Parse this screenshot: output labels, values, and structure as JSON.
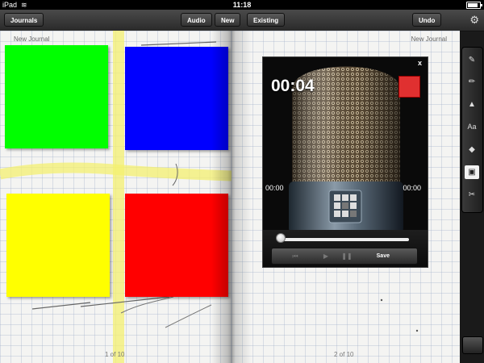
{
  "status_bar": {
    "carrier": "iPad",
    "wifi_icon": "wifi-icon",
    "time": "11:18",
    "battery_icon": "battery-icon"
  },
  "toolbar": {
    "journals_label": "Journals",
    "audio_label": "Audio",
    "new_label": "New",
    "existing_label": "Existing",
    "undo_label": "Undo",
    "settings_icon": "gear-icon"
  },
  "left_page": {
    "title": "New Journal",
    "page_indicator": "1 of 10",
    "swatches": [
      {
        "name": "green",
        "color": "#00ff00"
      },
      {
        "name": "blue",
        "color": "#0000ff"
      },
      {
        "name": "yellow",
        "color": "#ffff00"
      },
      {
        "name": "red",
        "color": "#ff0000"
      }
    ]
  },
  "right_page": {
    "title": "New Journal",
    "page_indicator": "2 of 10"
  },
  "recorder": {
    "close_label": "x",
    "elapsed": "00:04",
    "position_time": "00:00",
    "duration_time": "00:00",
    "save_label": "Save",
    "progress": 0,
    "record_indicator_color": "#e03030"
  },
  "tool_palette": {
    "tools": [
      {
        "name": "pen-icon",
        "glyph": "✎"
      },
      {
        "name": "marker-icon",
        "glyph": "✏"
      },
      {
        "name": "highlighter-icon",
        "glyph": "▲"
      },
      {
        "name": "text-icon",
        "glyph": "Aa"
      },
      {
        "name": "eraser-icon",
        "glyph": "◆"
      },
      {
        "name": "media-icon",
        "glyph": "▣"
      },
      {
        "name": "scissors-icon",
        "glyph": "✂"
      }
    ],
    "active_tool": "media-icon"
  }
}
